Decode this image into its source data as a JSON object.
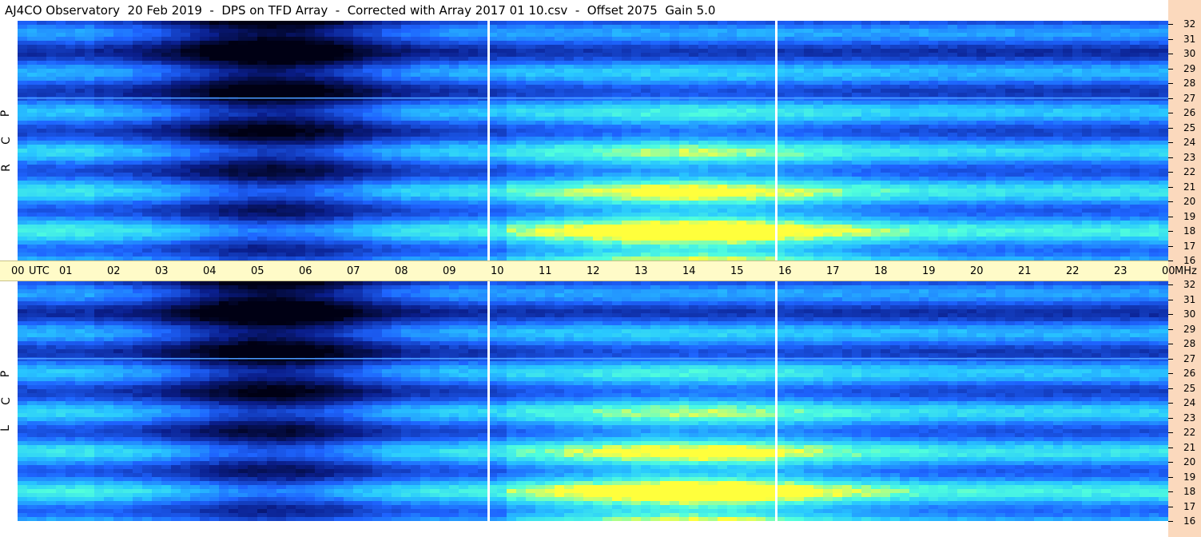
{
  "title": "AJ4CO Observatory  20 Feb 2019  -  DPS on TFD Array  -  Corrected with Array 2017 01 10.csv  -  Offset 2075  Gain 5.0",
  "time_axis": {
    "labels": [
      "00",
      "UTC",
      "01",
      "02",
      "03",
      "04",
      "05",
      "06",
      "07",
      "08",
      "09",
      "10",
      "11",
      "12",
      "13",
      "14",
      "15",
      "16",
      "17",
      "18",
      "19",
      "20",
      "21",
      "22",
      "23",
      "00",
      "MHz"
    ]
  },
  "panels": {
    "top": {
      "polarization_letters": [
        "R",
        "C",
        "P"
      ]
    },
    "bottom": {
      "polarization_letters": [
        "L",
        "C",
        "P"
      ]
    }
  },
  "freq_ticks": [
    "32",
    "31",
    "30",
    "29",
    "28",
    "27",
    "26",
    "25",
    "24",
    "23",
    "22",
    "21",
    "20",
    "19",
    "18",
    "17",
    "16"
  ],
  "chart_data": [
    {
      "type": "heatmap",
      "title": "R C P",
      "x": {
        "unit": "UTC hour",
        "range": [
          0,
          24
        ],
        "ticks": [
          "00",
          "01",
          "02",
          "03",
          "04",
          "05",
          "06",
          "07",
          "08",
          "09",
          "10",
          "11",
          "12",
          "13",
          "14",
          "15",
          "16",
          "17",
          "18",
          "19",
          "20",
          "21",
          "22",
          "23",
          "00"
        ]
      },
      "y": {
        "unit": "MHz",
        "range": [
          16,
          32
        ],
        "ticks": [
          32,
          31,
          30,
          29,
          28,
          27,
          26,
          25,
          24,
          23,
          22,
          21,
          20,
          19,
          18,
          17,
          16
        ]
      },
      "data_gaps_utc": [
        9.9,
        15.9
      ],
      "colors": {
        "low": "#000020",
        "mid": "#1f6cff",
        "high": "#38f0ff",
        "peak": "#ffff40"
      }
    },
    {
      "type": "heatmap",
      "title": "L C P",
      "x": {
        "unit": "UTC hour",
        "range": [
          0,
          24
        ],
        "ticks": [
          "00",
          "01",
          "02",
          "03",
          "04",
          "05",
          "06",
          "07",
          "08",
          "09",
          "10",
          "11",
          "12",
          "13",
          "14",
          "15",
          "16",
          "17",
          "18",
          "19",
          "20",
          "21",
          "22",
          "23",
          "00"
        ]
      },
      "y": {
        "unit": "MHz",
        "range": [
          16,
          32
        ],
        "ticks": [
          32,
          31,
          30,
          29,
          28,
          27,
          26,
          25,
          24,
          23,
          22,
          21,
          20,
          19,
          18,
          17,
          16
        ]
      },
      "data_gaps_utc": [
        9.9,
        15.9
      ],
      "colors": {
        "low": "#000020",
        "mid": "#1f6cff",
        "high": "#38f0ff",
        "peak": "#ffff40"
      }
    }
  ]
}
